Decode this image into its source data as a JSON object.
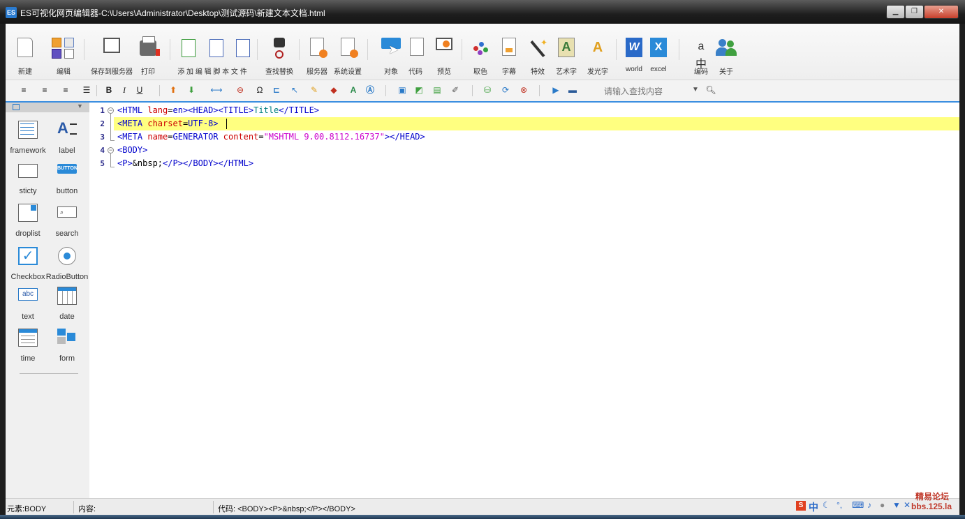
{
  "window": {
    "app_icon_text": "ES",
    "title": "ES可视化网页编辑器-C:\\Users\\Administrator\\Desktop\\测试源码\\新建文本文档.html"
  },
  "toolbar1": {
    "new": "新建",
    "edit": "编辑",
    "save_to_server": "保存到服务器",
    "print": "打印",
    "add_edit_script": "添 加 编 辑 脚 本 文 件",
    "find_replace": "查找替换",
    "server": "服务器",
    "system_settings": "系统设置",
    "object": "对象",
    "code": "代码",
    "preview": "预览",
    "pick_color": "取色",
    "subtitle": "字幕",
    "effects": "特效",
    "art_text": "艺术字",
    "glow_text": "发光字",
    "world": "world",
    "excel": "excel",
    "encoding": "编码",
    "about": "关于"
  },
  "toolbar2": {
    "bold": "B",
    "italic": "I",
    "underline": "U",
    "omega": "Ω",
    "font_a": "A",
    "search_placeholder": "请输入查找内容",
    "colors": {
      "accent": "#3c8fe0"
    }
  },
  "sidebar": {
    "components": [
      {
        "label": "framework",
        "icon": "framework-icon"
      },
      {
        "label": "label",
        "icon": "label-icon"
      },
      {
        "label": "sticty",
        "icon": "sticky-icon"
      },
      {
        "label": "button",
        "icon": "button-icon",
        "icon_text": "BUTTON"
      },
      {
        "label": "droplist",
        "icon": "droplist-icon"
      },
      {
        "label": "search",
        "icon": "search-icon"
      },
      {
        "label": "Checkbox",
        "icon": "checkbox-icon"
      },
      {
        "label": "RadioButton",
        "icon": "radio-icon"
      },
      {
        "label": "text",
        "icon": "text-icon",
        "icon_text": "abc"
      },
      {
        "label": "date",
        "icon": "date-icon"
      },
      {
        "label": "time",
        "icon": "time-icon"
      },
      {
        "label": "form",
        "icon": "form-icon"
      }
    ]
  },
  "editor": {
    "line_numbers": [
      "1",
      "2",
      "3",
      "4",
      "5"
    ],
    "lines": [
      [
        {
          "t": "tag",
          "v": "<HTML "
        },
        {
          "t": "attr",
          "v": "lang"
        },
        {
          "t": "plain",
          "v": "="
        },
        {
          "t": "val",
          "v": "en"
        },
        {
          "t": "tag",
          "v": "><HEAD><TITLE>"
        },
        {
          "t": "txt",
          "v": "Title"
        },
        {
          "t": "tag",
          "v": "</TITLE>"
        }
      ],
      [
        {
          "t": "tag",
          "v": "<META "
        },
        {
          "t": "attr",
          "v": "charset"
        },
        {
          "t": "plain",
          "v": "="
        },
        {
          "t": "val",
          "v": "UTF-8"
        },
        {
          "t": "tag",
          "v": ">"
        }
      ],
      [
        {
          "t": "tag",
          "v": "<META "
        },
        {
          "t": "attr",
          "v": "name"
        },
        {
          "t": "plain",
          "v": "="
        },
        {
          "t": "val",
          "v": "GENERATOR "
        },
        {
          "t": "attr",
          "v": "content"
        },
        {
          "t": "plain",
          "v": "="
        },
        {
          "t": "str",
          "v": "\"MSHTML 9.00.8112.16737\""
        },
        {
          "t": "tag",
          "v": "></HEAD>"
        }
      ],
      [
        {
          "t": "tag",
          "v": "<BODY>"
        }
      ],
      [
        {
          "t": "tag",
          "v": "<P>"
        },
        {
          "t": "plain",
          "v": "&nbsp;"
        },
        {
          "t": "tag",
          "v": "</P></BODY></HTML>"
        }
      ]
    ]
  },
  "statusbar": {
    "element": "元素:BODY",
    "content": "内容:",
    "code": "代码:  <BODY><P>&nbsp;</P></BODY>",
    "ime_chinese": "中"
  },
  "watermark": {
    "line1": "精易论坛",
    "line2": "bbs.125.la"
  }
}
